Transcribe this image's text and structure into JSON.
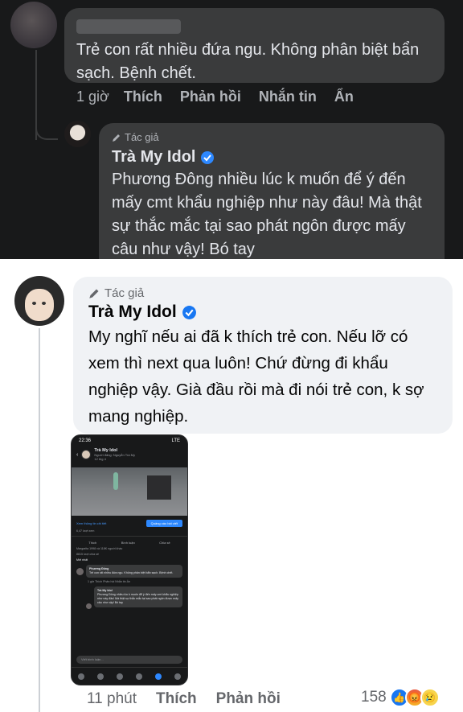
{
  "top_comment": {
    "text": "Trẻ con rất nhiều đứa ngu. Không phân biệt bẩn sạch. Bệnh chết.",
    "time": "1 giờ",
    "actions": [
      "Thích",
      "Phản hồi",
      "Nhắn tin",
      "Ẩn"
    ]
  },
  "dark_reply": {
    "author_badge": "Tác giả",
    "name": "Trà My Idol",
    "text": "Phương Đông nhiều lúc k muốn để ý đến mấy cmt khẩu nghiệp như này đâu! Mà thật sự thắc mắc tại sao phát ngôn được mấy câu như vậy! Bó tay"
  },
  "light_reply": {
    "author_badge": "Tác giả",
    "name": "Trà My Idol",
    "text": "My nghĩ nếu ai đã k thích trẻ con. Nếu lỡ có xem thì next qua luôn! Chứ đừng đi khẩu nghiệp vậy. Già đầu rồi mà đi nói trẻ con, k sợ mang nghiệp.",
    "time": "11 phút",
    "actions": [
      "Thích",
      "Phản hồi"
    ],
    "reaction_count": "158",
    "reactions": [
      "like-icon",
      "angry-icon",
      "sad-icon"
    ]
  },
  "phone": {
    "clock": "22:36",
    "signal": "LTE",
    "page_name": "Trà My Idol",
    "page_sub": "Người đăng: Nguyễn Trà My",
    "page_time": "12 thg 4",
    "stats_link": "Xem thông tin chi tiết",
    "boost": "Quảng cáo bài viết",
    "views": "6,47 lượt xem",
    "actions": [
      "Thích",
      "Bình luận",
      "Chia sẻ"
    ],
    "reaction_line": "Margarita 1998 và 118K người khác",
    "shares": "8815 lượt chia sẻ",
    "sort": "Mới nhất",
    "comment_name": "Phương Đông",
    "comment_text": "Trẻ con rất nhiều đứa ngu. Không phân biệt bẩn sạch. Bệnh chết.",
    "comment_actions": "1 giờ  Thích  Phản hồi  Nhắn tin  Ẩn",
    "reply_name": "Trà My Idol",
    "reply_text": "Phương Đông nhiều lúc k muốn để ý đến mấy cmt khẩu nghiệp như này đâu! Mà thật sự thắc mắc tại sao phát ngôn được mấy câu như vậy! Bó tay",
    "input_placeholder": "Viết bình luận..."
  }
}
